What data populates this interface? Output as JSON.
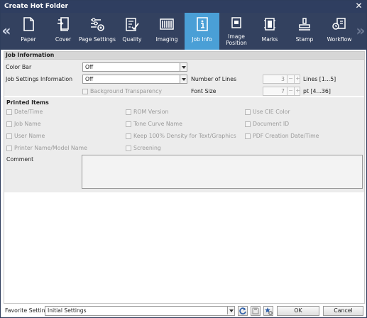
{
  "window": {
    "title": "Create Hot Folder"
  },
  "toolbar": {
    "tabs": [
      {
        "label": "Paper",
        "icon": "paper-icon"
      },
      {
        "label": "Cover",
        "icon": "cover-icon"
      },
      {
        "label": "Page Settings",
        "icon": "page-settings-icon"
      },
      {
        "label": "Quality",
        "icon": "quality-icon"
      },
      {
        "label": "Imaging",
        "icon": "imaging-icon"
      },
      {
        "label": "Job Info",
        "icon": "job-info-icon",
        "active": true
      },
      {
        "label": "Image Position",
        "icon": "image-position-icon"
      },
      {
        "label": "Marks",
        "icon": "marks-icon"
      },
      {
        "label": "Stamp",
        "icon": "stamp-icon"
      },
      {
        "label": "Workflow",
        "icon": "workflow-icon"
      }
    ],
    "prev_glyph": "«",
    "next_glyph": "»",
    "active_color": "#4a9fd6"
  },
  "job_info": {
    "header": "Job Information",
    "color_bar_label": "Color Bar",
    "color_bar_value": "Off",
    "job_settings_label": "Job Settings Information",
    "job_settings_value": "Off",
    "bg_transparency_label": "Background Transparency",
    "number_of_lines_label": "Number of Lines",
    "number_of_lines_value": "3",
    "number_of_lines_range": "Lines [1...5]",
    "font_size_label": "Font Size",
    "font_size_value": "7",
    "font_size_range": "pt [4...36]",
    "minus": "−",
    "plus": "+"
  },
  "printed_items": {
    "header": "Printed Items",
    "col1": [
      "Date/Time",
      "Job Name",
      "User Name",
      "Printer Name/Model Name"
    ],
    "col2": [
      "ROM Version",
      "Tone Curve Name",
      "Keep 100% Density for Text/Graphics",
      "Screening"
    ],
    "col3": [
      "Use CIE Color",
      "Document ID",
      "PDF Creation Date/Time"
    ],
    "comment_label": "Comment"
  },
  "footer": {
    "favorite_label": "Favorite Setting",
    "favorite_value": "Initial Settings",
    "ok_label": "OK",
    "cancel_label": "Cancel"
  }
}
